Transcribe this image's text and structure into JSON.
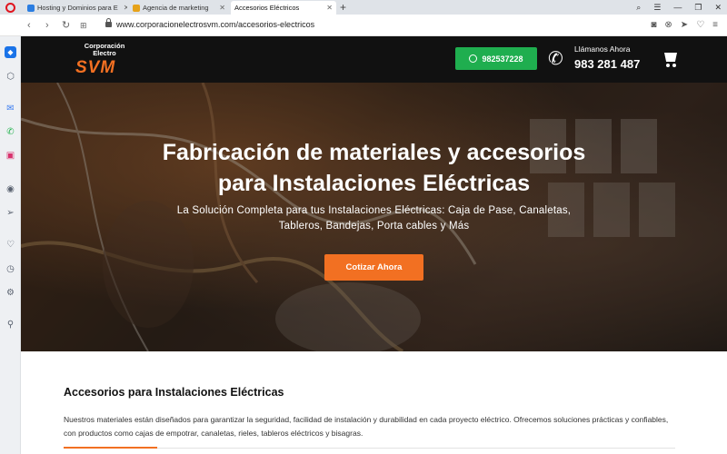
{
  "browser": {
    "tabs": [
      {
        "title": "Hosting y Dominios para E",
        "favicon_color": "#2b7de1"
      },
      {
        "title": "Agencia de marketing",
        "favicon_color": "#e6a21a"
      },
      {
        "title": "Accesorios Eléctricos",
        "favicon_color": "#f27022"
      }
    ],
    "url": "www.corporacionelectrosvm.com/accesorios-electricos"
  },
  "sidebar": {
    "icons": [
      "home-icon",
      "messenger-icon",
      "whatsapp-icon",
      "instagram-icon",
      "player-icon",
      "send-icon",
      "heart-icon",
      "history-icon",
      "settings-icon",
      "pin-icon"
    ]
  },
  "header": {
    "logo_line1": "Corporación",
    "logo_line2": "Electro",
    "logo_brand": "SVM",
    "whatsapp_number": "982537228",
    "call_label": "Llámanos Ahora",
    "call_number": "983 281 487"
  },
  "hero": {
    "title_line1": "Fabricación de materiales y accesorios",
    "title_line2": "para Instalaciones Eléctricas",
    "subtitle_line1": "La Solución Completa para tus Instalaciones Eléctricas: Caja de Pase, Canaletas,",
    "subtitle_line2": "Tableros, Bandejas, Porta cables y Más",
    "cta_label": "Cotizar Ahora"
  },
  "section": {
    "title": "Accesorios para Instalaciones Eléctricas",
    "text": "Nuestros materiales están diseñados para garantizar la seguridad, facilidad de instalación y durabilidad en cada proyecto eléctrico. Ofrecemos soluciones prácticas y confiables, con productos como cajas de empotrar, canaletas, rieles, tableros eléctricos y bisagras."
  },
  "colors": {
    "accent": "#f27022",
    "whatsapp": "#1fae4f",
    "header_bg": "#111111"
  }
}
